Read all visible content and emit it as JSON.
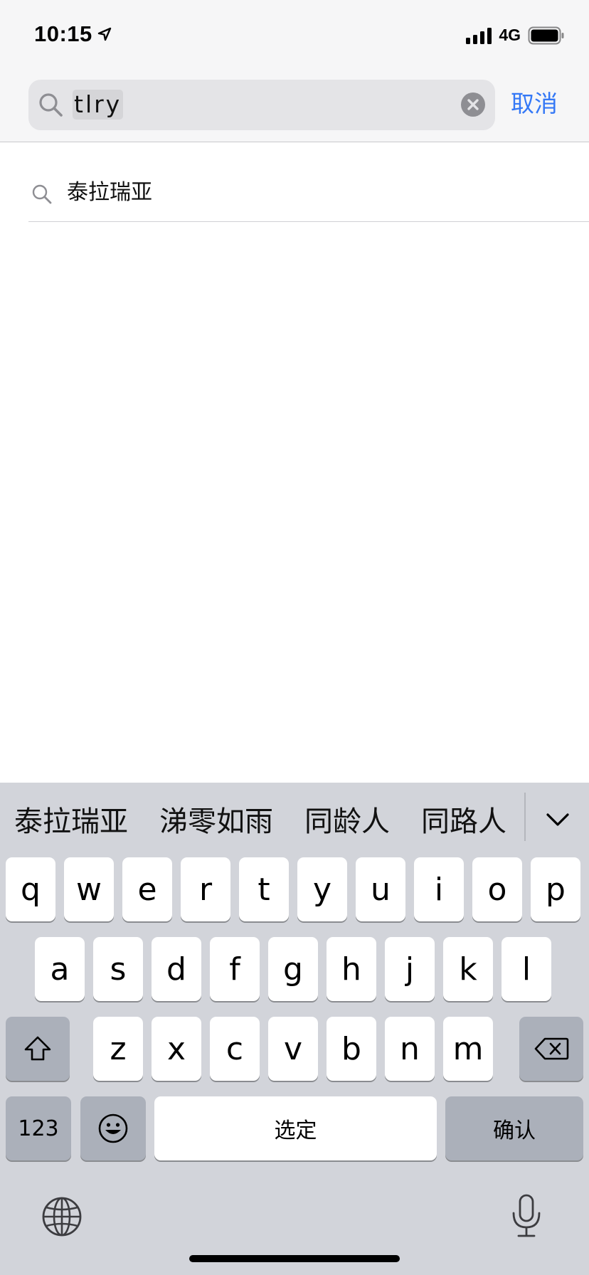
{
  "status_bar": {
    "time": "10:15",
    "network": "4G"
  },
  "search": {
    "query": "tlry",
    "cancel_label": "取消"
  },
  "suggestions": [
    {
      "text": "泰拉瑞亚"
    }
  ],
  "keyboard": {
    "candidates": [
      "泰拉瑞亚",
      "涕零如雨",
      "同龄人",
      "同路人"
    ],
    "row1": [
      "q",
      "w",
      "e",
      "r",
      "t",
      "y",
      "u",
      "i",
      "o",
      "p"
    ],
    "row2": [
      "a",
      "s",
      "d",
      "f",
      "g",
      "h",
      "j",
      "k",
      "l"
    ],
    "row3": [
      "z",
      "x",
      "c",
      "v",
      "b",
      "n",
      "m"
    ],
    "numbers_label": "123",
    "space_label": "选定",
    "return_label": "确认"
  },
  "colors": {
    "accent": "#3478f6",
    "keyboard_bg": "#d2d4da",
    "key_dark": "#abb0ba",
    "topbar_bg": "#f6f6f7"
  }
}
